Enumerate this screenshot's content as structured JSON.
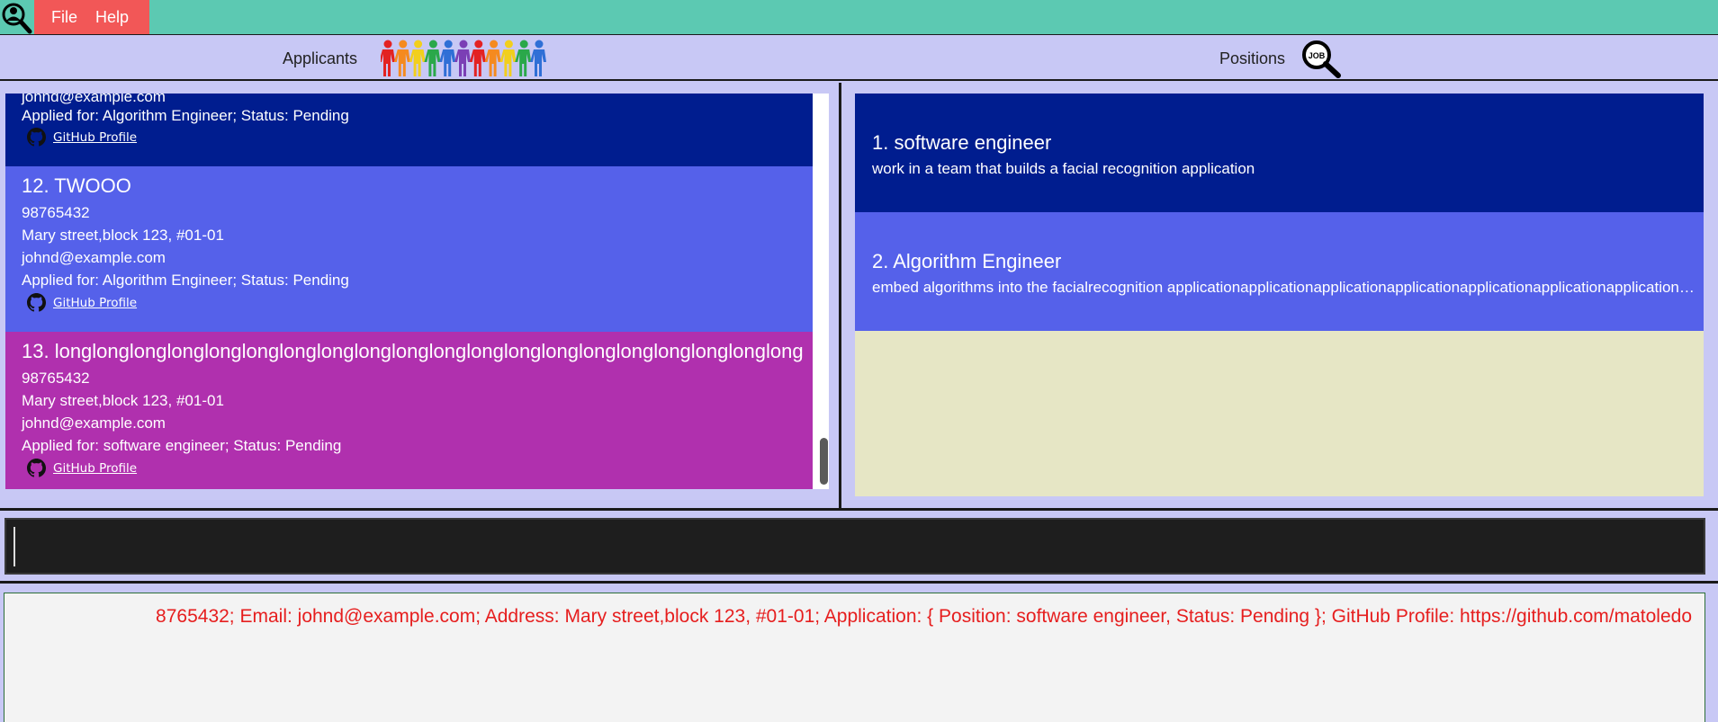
{
  "menu": {
    "items": [
      "File",
      "Help"
    ],
    "logo_icon": "person-search-icon"
  },
  "header": {
    "applicants_label": "Applicants",
    "positions_label": "Positions",
    "people_icon": "people-row-icon",
    "job_icon": "job-search-icon"
  },
  "applicants": [
    {
      "email": "johnd@example.com",
      "application": "Applied for: Algorithm Engineer; Status: Pending",
      "github_label": "GitHub Profile",
      "color": "#001d8f"
    },
    {
      "title": "12.  TWOOO",
      "phone": "98765432",
      "address": "Mary street,block 123, #01-01",
      "email": "johnd@example.com",
      "application": "Applied for: Algorithm Engineer; Status: Pending",
      "github_label": "GitHub Profile",
      "color": "#5561ea"
    },
    {
      "title": "13.  longlonglonglonglonglonglonglonglonglonglonglonglonglonglonglonglonglonglonglong",
      "phone": "98765432",
      "address": "Mary street,block 123, #01-01",
      "email": "johnd@example.com",
      "application": "Applied for: software engineer; Status: Pending",
      "github_label": "GitHub Profile",
      "color": "#b030ae"
    }
  ],
  "positions": [
    {
      "title": "1.  software engineer",
      "description": "work in a team that builds a facial recognition application"
    },
    {
      "title": "2.  Algorithm Engineer",
      "description": "embed algorithms into the facialrecognition applicationapplicationapplicationapplicationapplicationapplicationapplicationapplication"
    }
  ],
  "command": {
    "value": "",
    "placeholder": ""
  },
  "result": {
    "text": "8765432; Email: johnd@example.com; Address: Mary street,block 123, #01-01; Application: { Position: software engineer, Status: Pending }; GitHub Profile: https://github.com/matoledo"
  },
  "colors": {
    "menubar": "#5cc9b2",
    "menu_group": "#f25757",
    "background": "#c8c8f5",
    "card_dark_blue": "#001d8f",
    "card_blue": "#5561ea",
    "card_purple": "#b030ae",
    "positions_empty": "#e6e6c5",
    "command_bg": "#1e1e1e",
    "result_text": "#e61e1e"
  }
}
